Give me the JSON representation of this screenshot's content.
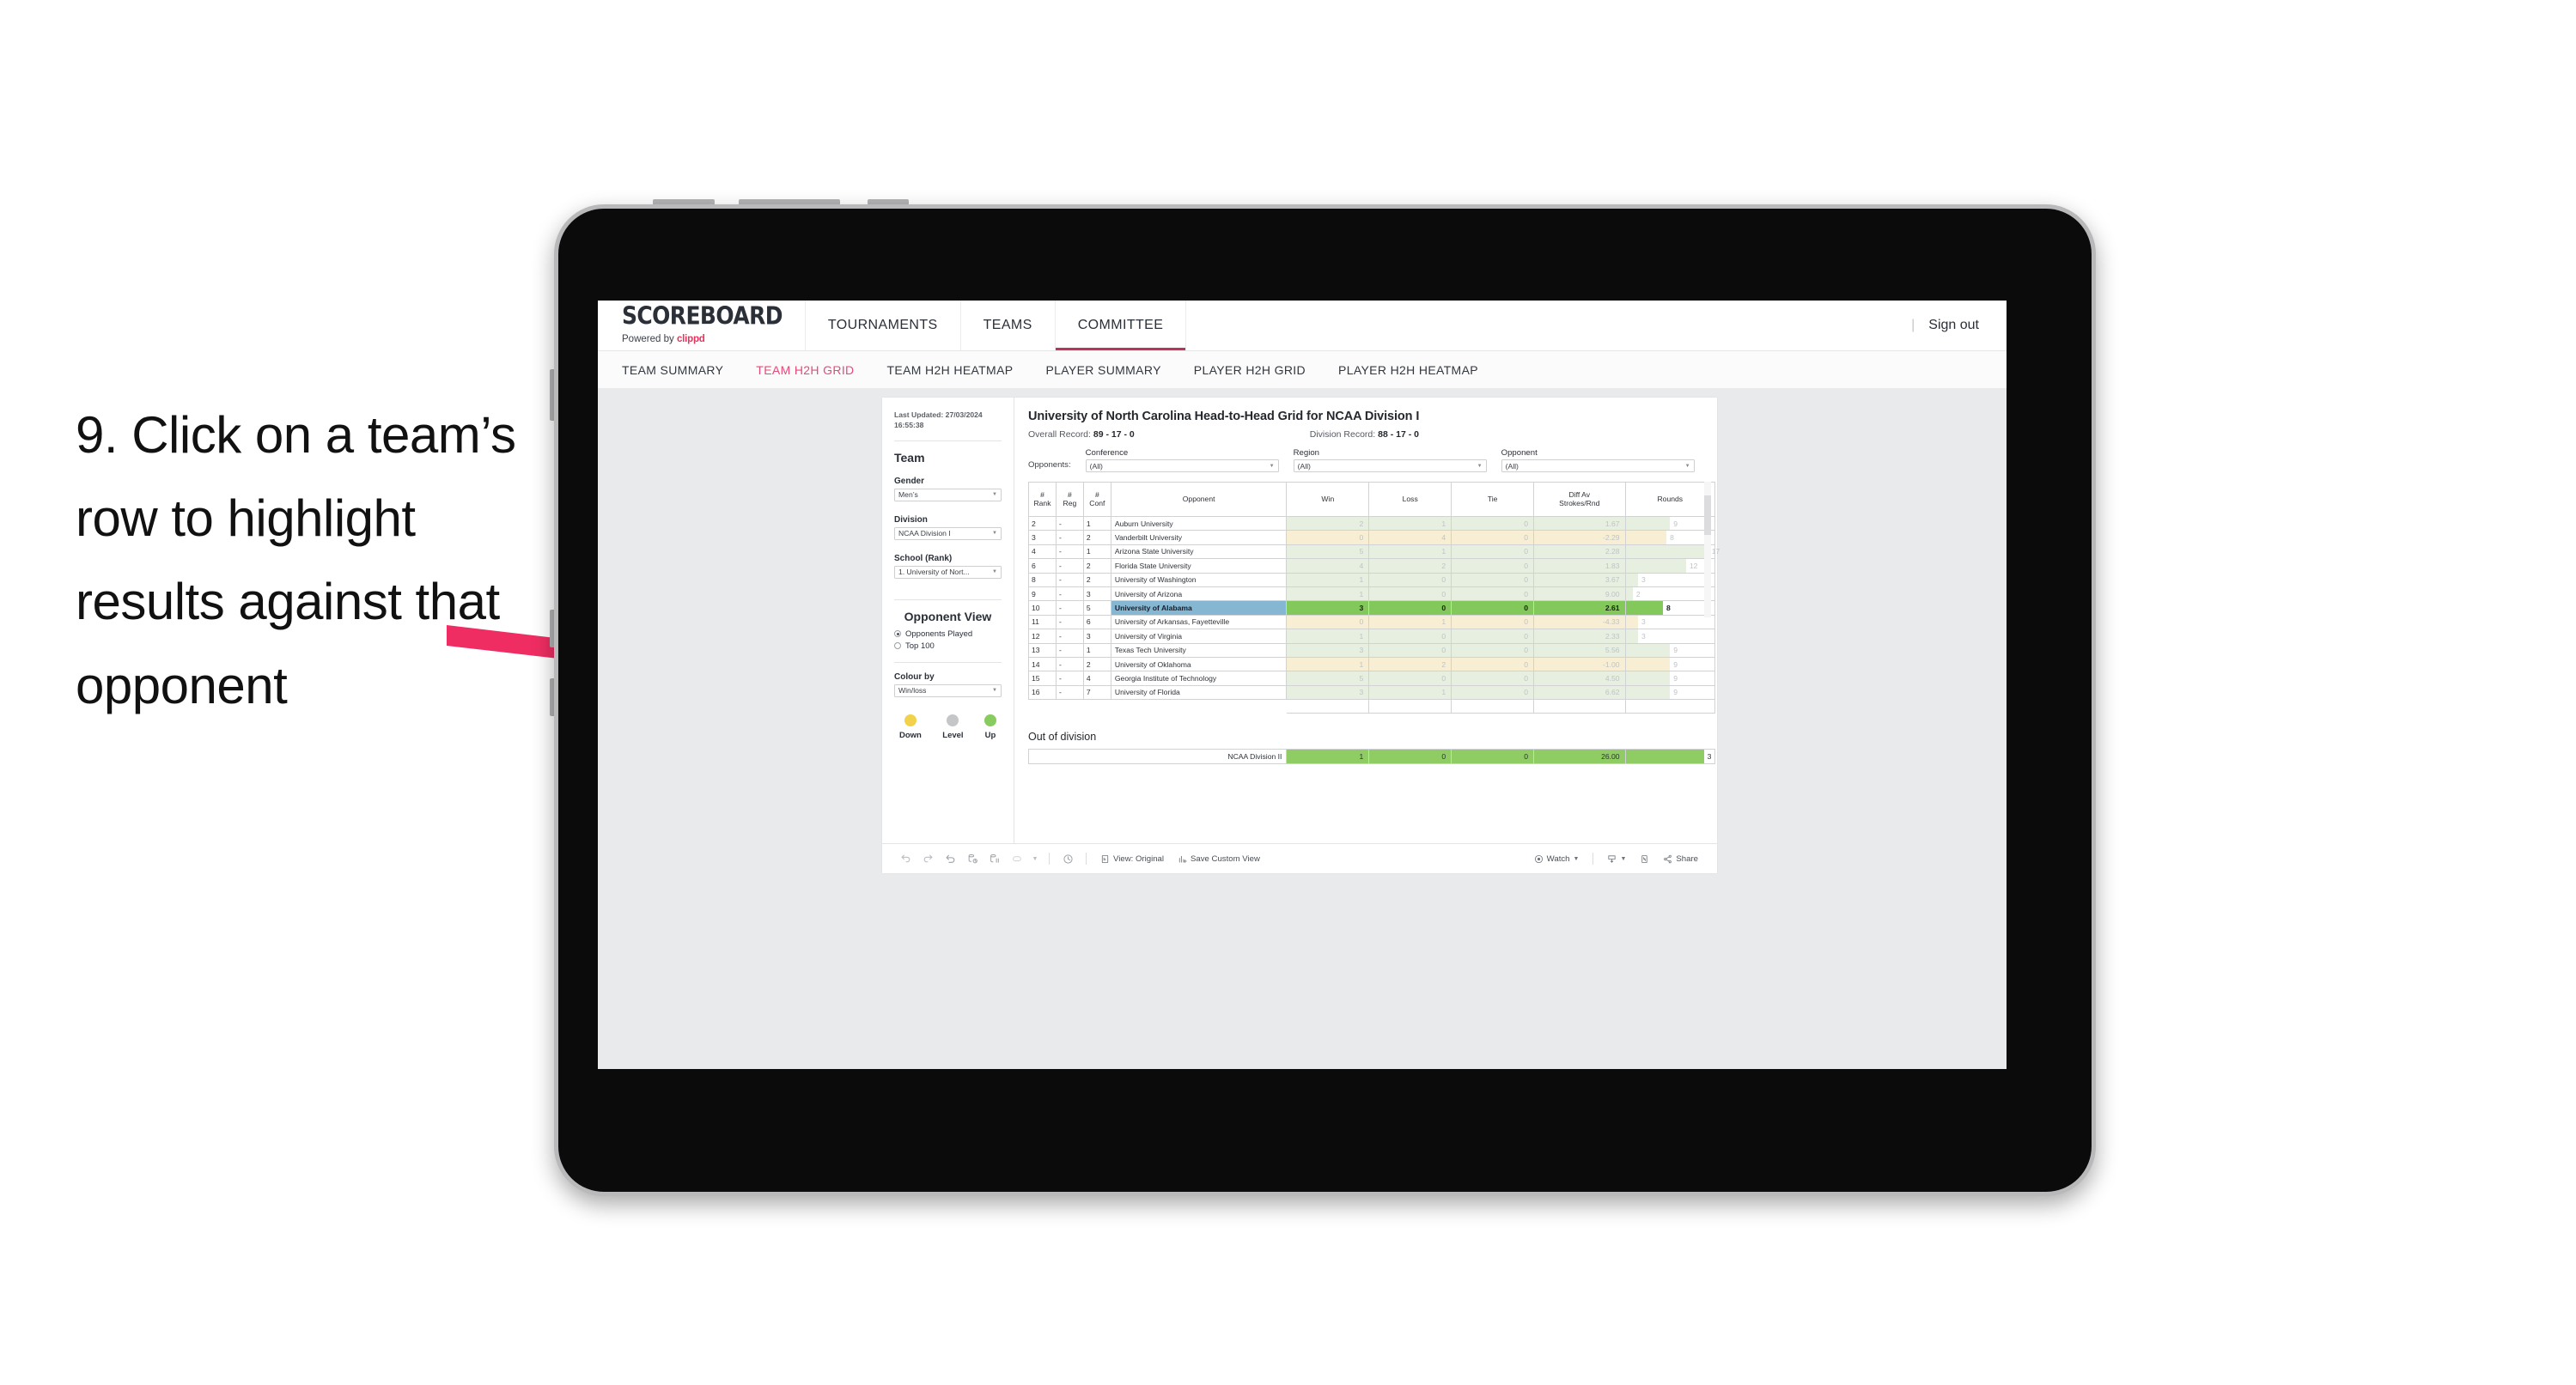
{
  "annotation": {
    "text": "9. Click on a team’s row to highlight results against that opponent"
  },
  "app": {
    "logo_main": "SCOREBOARD",
    "logo_sub_prefix": "Powered by ",
    "logo_sub_brand": "clippd",
    "main_nav": [
      {
        "label": "TOURNAMENTS",
        "active": false
      },
      {
        "label": "TEAMS",
        "active": false
      },
      {
        "label": "COMMITTEE",
        "active": true
      }
    ],
    "signout_sep": "|",
    "signout_label": "Sign out",
    "sub_nav": [
      {
        "label": "TEAM SUMMARY",
        "active": false
      },
      {
        "label": "TEAM H2H GRID",
        "active": true
      },
      {
        "label": "TEAM H2H HEATMAP",
        "active": false
      },
      {
        "label": "PLAYER SUMMARY",
        "active": false
      },
      {
        "label": "PLAYER H2H GRID",
        "active": false
      },
      {
        "label": "PLAYER H2H HEATMAP",
        "active": false
      }
    ],
    "accent_color": "#e8497a",
    "tab_underline_color": "#b9365a"
  },
  "sidebar": {
    "last_updated": "Last Updated: 27/03/2024 16:55:38",
    "team_heading": "Team",
    "gender_label": "Gender",
    "gender_value": "Men’s",
    "division_label": "Division",
    "division_value": "NCAA Division I",
    "school_label": "School (Rank)",
    "school_value": "1. University of Nort...",
    "opponent_view_heading": "Opponent View",
    "radios": [
      {
        "label": "Opponents Played",
        "selected": true
      },
      {
        "label": "Top 100",
        "selected": false
      }
    ],
    "colour_by_label": "Colour by",
    "colour_by_value": "Win/loss",
    "legend": [
      {
        "label": "Down",
        "color": "#f2d24b"
      },
      {
        "label": "Level",
        "color": "#c4c6c8"
      },
      {
        "label": "Up",
        "color": "#88cc60"
      }
    ]
  },
  "main": {
    "title": "University of North Carolina Head-to-Head Grid for NCAA Division I",
    "overall_record_label": "Overall Record: ",
    "overall_record_value": "89 - 17 - 0",
    "division_record_label": "Division Record: ",
    "division_record_value": "88 - 17 - 0",
    "opponents_label": "Opponents:",
    "filters": [
      {
        "label": "Conference",
        "value": "(All)"
      },
      {
        "label": "Region",
        "value": "(All)"
      },
      {
        "label": "Opponent",
        "value": "(All)"
      }
    ],
    "out_of_division_title": "Out of division",
    "out_of_division_row": {
      "label": "NCAA Division II",
      "win": "1",
      "loss": "0",
      "tie": "0",
      "diff": "26.00",
      "rounds": "3",
      "rounds_bar_pct": 88
    }
  },
  "table": {
    "headers": {
      "rank": "#\nRank",
      "reg": "#\nReg",
      "conf": "#\nConf",
      "opponent": "Opponent",
      "win": "Win",
      "loss": "Loss",
      "tie": "Tie",
      "diff": "Diff Av\nStrokes/Rnd",
      "rounds": "Rounds"
    },
    "rows": [
      {
        "rank": "2",
        "reg": "-",
        "conf": "1",
        "opponent": "Auburn University",
        "win": "2",
        "loss": "1",
        "tie": "0",
        "diff": "1.67",
        "rounds": "9",
        "bar_pct": 50,
        "tone": "up",
        "highlight": false
      },
      {
        "rank": "3",
        "reg": "-",
        "conf": "2",
        "opponent": "Vanderbilt University",
        "win": "0",
        "loss": "4",
        "tie": "0",
        "diff": "-2.29",
        "rounds": "8",
        "bar_pct": 46,
        "tone": "down",
        "highlight": false
      },
      {
        "rank": "4",
        "reg": "-",
        "conf": "1",
        "opponent": "Arizona State University",
        "win": "5",
        "loss": "1",
        "tie": "0",
        "diff": "2.28",
        "rounds": "17",
        "bar_pct": 93,
        "tone": "up",
        "highlight": false
      },
      {
        "rank": "6",
        "reg": "-",
        "conf": "2",
        "opponent": "Florida State University",
        "win": "4",
        "loss": "2",
        "tie": "0",
        "diff": "1.83",
        "rounds": "12",
        "bar_pct": 68,
        "tone": "up",
        "highlight": false
      },
      {
        "rank": "8",
        "reg": "-",
        "conf": "2",
        "opponent": "University of Washington",
        "win": "1",
        "loss": "0",
        "tie": "0",
        "diff": "3.67",
        "rounds": "3",
        "bar_pct": 14,
        "tone": "up",
        "highlight": false
      },
      {
        "rank": "9",
        "reg": "-",
        "conf": "3",
        "opponent": "University of Arizona",
        "win": "1",
        "loss": "0",
        "tie": "0",
        "diff": "9.00",
        "rounds": "2",
        "bar_pct": 8,
        "tone": "up",
        "highlight": false
      },
      {
        "rank": "10",
        "reg": "-",
        "conf": "5",
        "opponent": "University of Alabama",
        "win": "3",
        "loss": "0",
        "tie": "0",
        "diff": "2.61",
        "rounds": "8",
        "bar_pct": 42,
        "tone": "up",
        "highlight": true
      },
      {
        "rank": "11",
        "reg": "-",
        "conf": "6",
        "opponent": "University of Arkansas, Fayetteville",
        "win": "0",
        "loss": "1",
        "tie": "0",
        "diff": "-4.33",
        "rounds": "3",
        "bar_pct": 14,
        "tone": "down",
        "highlight": false
      },
      {
        "rank": "12",
        "reg": "-",
        "conf": "3",
        "opponent": "University of Virginia",
        "win": "1",
        "loss": "0",
        "tie": "0",
        "diff": "2.33",
        "rounds": "3",
        "bar_pct": 14,
        "tone": "up",
        "highlight": false
      },
      {
        "rank": "13",
        "reg": "-",
        "conf": "1",
        "opponent": "Texas Tech University",
        "win": "3",
        "loss": "0",
        "tie": "0",
        "diff": "5.56",
        "rounds": "9",
        "bar_pct": 50,
        "tone": "up",
        "highlight": false
      },
      {
        "rank": "14",
        "reg": "-",
        "conf": "2",
        "opponent": "University of Oklahoma",
        "win": "1",
        "loss": "2",
        "tie": "0",
        "diff": "-1.00",
        "rounds": "9",
        "bar_pct": 50,
        "tone": "down",
        "highlight": false
      },
      {
        "rank": "15",
        "reg": "-",
        "conf": "4",
        "opponent": "Georgia Institute of Technology",
        "win": "5",
        "loss": "0",
        "tie": "0",
        "diff": "4.50",
        "rounds": "9",
        "bar_pct": 50,
        "tone": "up",
        "highlight": false
      },
      {
        "rank": "16",
        "reg": "-",
        "conf": "7",
        "opponent": "University of Florida",
        "win": "3",
        "loss": "1",
        "tie": "0",
        "diff": "6.62",
        "rounds": "9",
        "bar_pct": 50,
        "tone": "up",
        "highlight": false
      }
    ]
  },
  "toolbar": {
    "icons": [
      "undo-icon",
      "redo-icon",
      "revert-icon",
      "refresh-data-icon",
      "pause-updates-icon",
      "reset-layout-icon"
    ],
    "view_label": "View: Original",
    "save_label": "Save Custom View",
    "watch_label": "Watch",
    "share_label": "Share"
  }
}
